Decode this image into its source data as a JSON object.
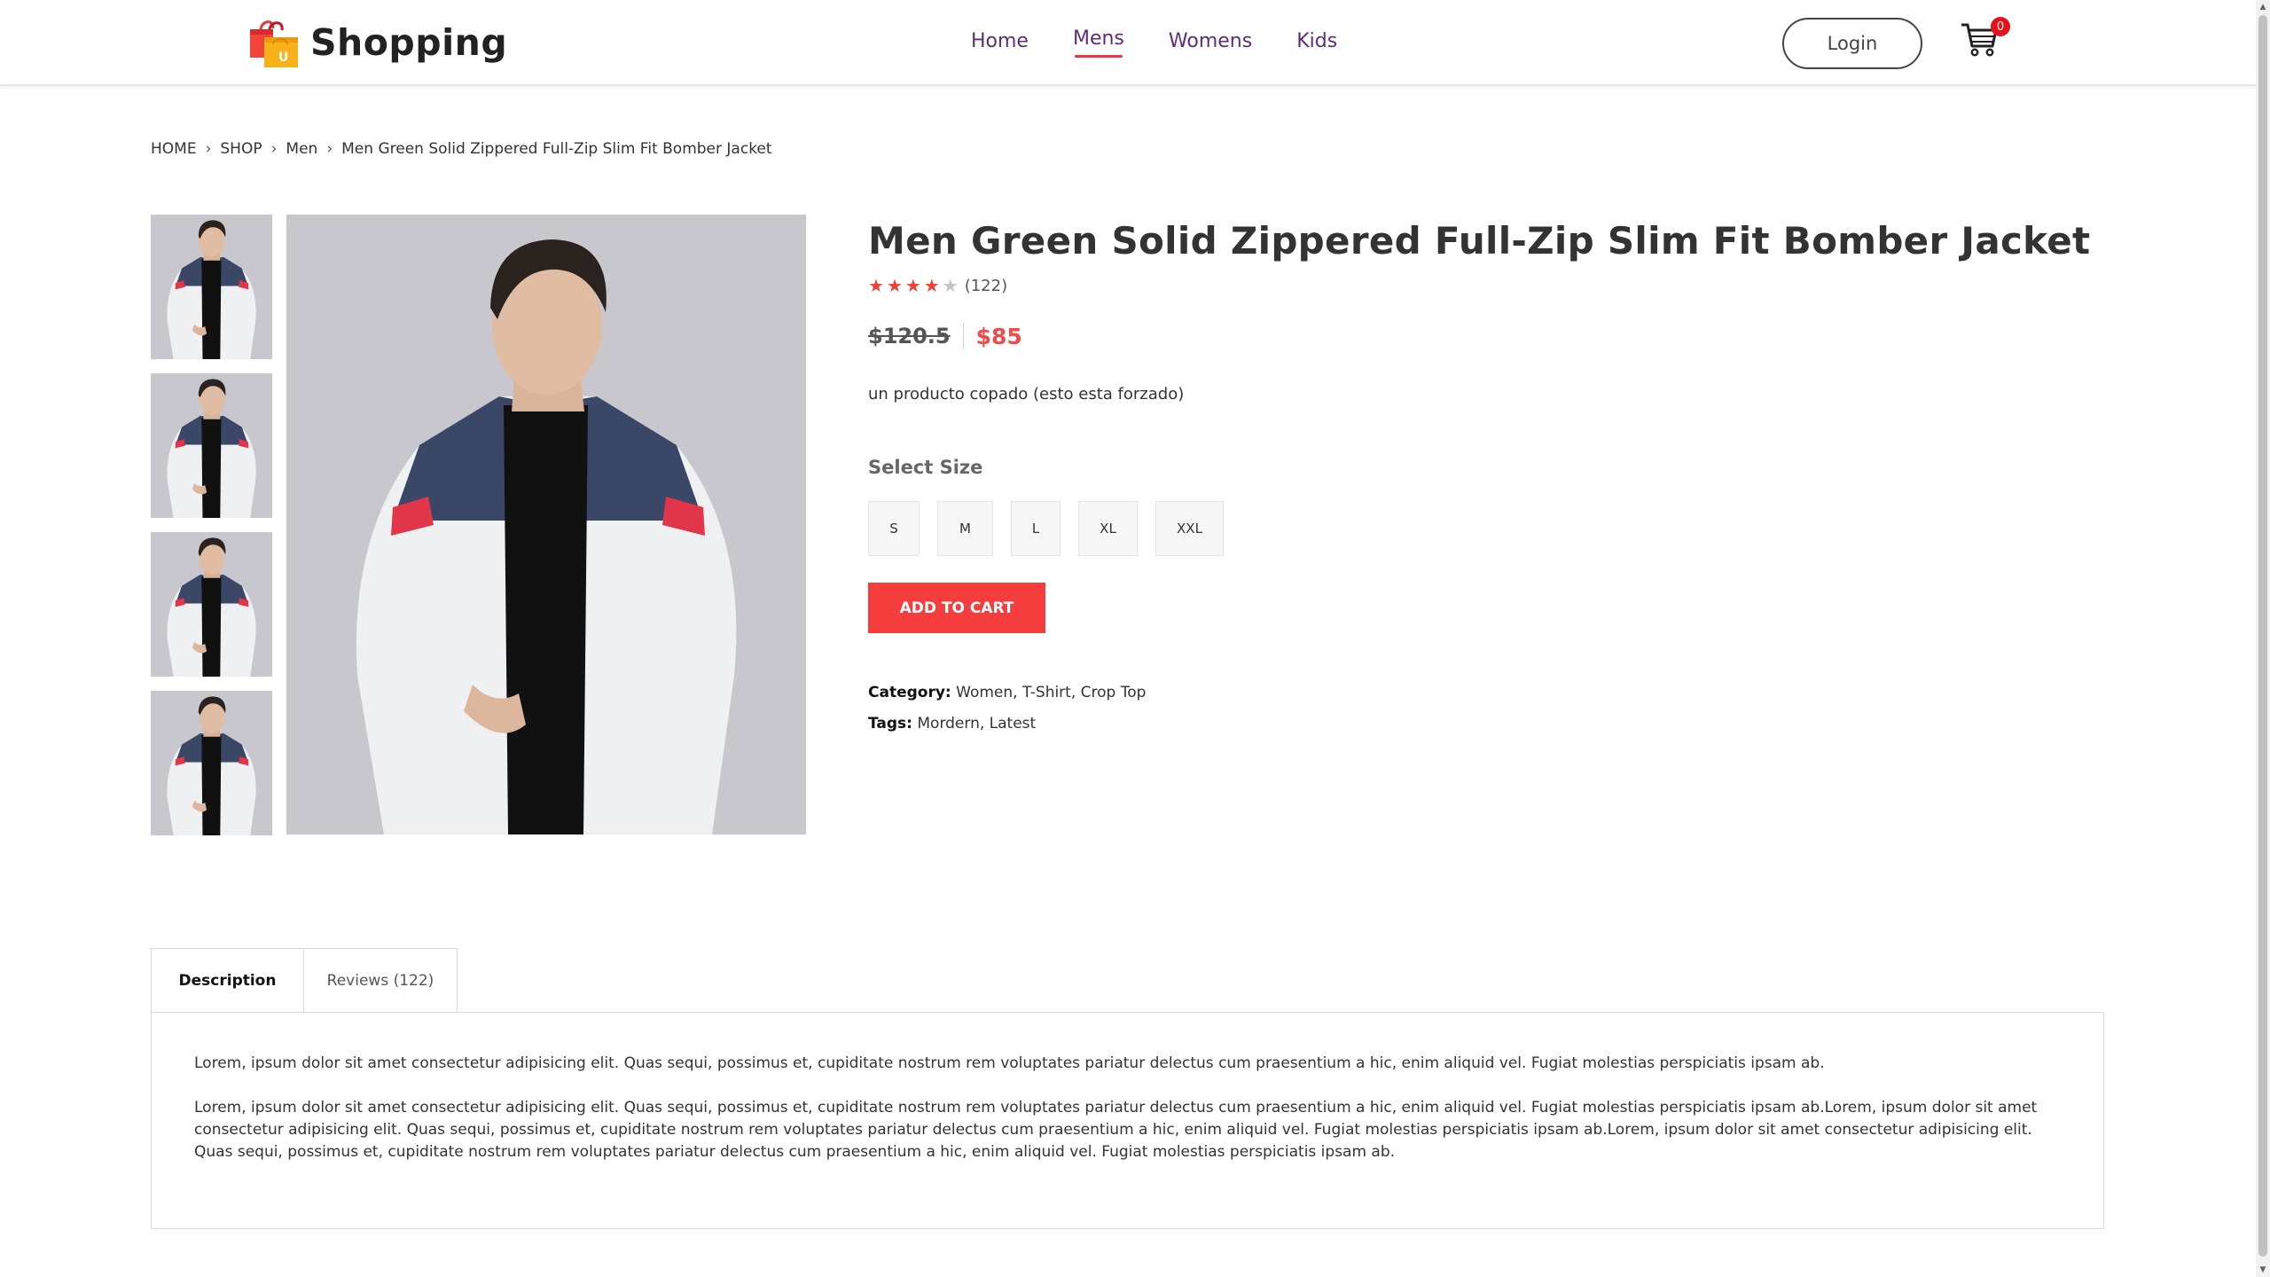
{
  "header": {
    "brand": "Shopping",
    "logo_letter": "U",
    "nav": [
      {
        "label": "Home",
        "active": false
      },
      {
        "label": "Mens",
        "active": true
      },
      {
        "label": "Womens",
        "active": false
      },
      {
        "label": "Kids",
        "active": false
      }
    ],
    "login_label": "Login",
    "cart_count": "0"
  },
  "breadcrumb": [
    "HOME",
    "SHOP",
    "Men",
    "Men Green Solid Zippered Full-Zip Slim Fit Bomber Jacket"
  ],
  "product": {
    "title": "Men Green Solid Zippered Full-Zip Slim Fit Bomber Jacket",
    "rating": 4,
    "rating_max": 5,
    "review_count": "(122)",
    "old_price": "$120.5",
    "price": "$85",
    "short_description": "un producto copado (esto esta forzado)",
    "select_size_label": "Select Size",
    "sizes": [
      "S",
      "M",
      "L",
      "XL",
      "XXL"
    ],
    "add_to_cart_label": "ADD TO CART",
    "category_label": "Category:",
    "category_value": "Women, T-Shirt, Crop Top",
    "tags_label": "Tags:",
    "tags_value": "Mordern, Latest",
    "thumbnail_count": 4
  },
  "tabs": {
    "items": [
      "Description",
      "Reviews (122)"
    ],
    "active": 0,
    "description": [
      "Lorem, ipsum dolor sit amet consectetur adipisicing elit. Quas sequi, possimus et, cupiditate nostrum rem voluptates pariatur delectus cum praesentium a hic, enim aliquid vel. Fugiat molestias perspiciatis ipsam ab.",
      "Lorem, ipsum dolor sit amet consectetur adipisicing elit. Quas sequi, possimus et, cupiditate nostrum rem voluptates pariatur delectus cum praesentium a hic, enim aliquid vel. Fugiat molestias perspiciatis ipsam ab.Lorem, ipsum dolor sit amet consectetur adipisicing elit. Quas sequi, possimus et, cupiditate nostrum rem voluptates pariatur delectus cum praesentium a hic, enim aliquid vel. Fugiat molestias perspiciatis ipsam ab.Lorem, ipsum dolor sit amet consectetur adipisicing elit. Quas sequi, possimus et, cupiditate nostrum rem voluptates pariatur delectus cum praesentium a hic, enim aliquid vel. Fugiat molestias perspiciatis ipsam ab."
    ]
  },
  "colors": {
    "accent": "#f53d3d",
    "nav_text": "#5e2b7e",
    "price": "#f04a4a"
  },
  "icons": {
    "logo": "shopping-bag-icon",
    "cart": "shopping-cart-icon",
    "breadcrumb_separator": "chevron-right-icon",
    "rating": "star-icon"
  }
}
